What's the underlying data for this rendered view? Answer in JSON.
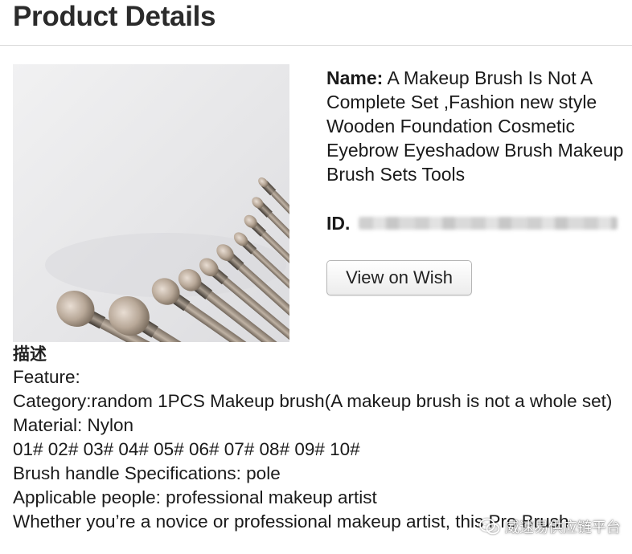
{
  "page": {
    "title": "Product Details"
  },
  "product": {
    "image_alt": "Makeup brush set",
    "name_label": "Name:",
    "name_value": "A Makeup Brush Is Not A Complete Set ,Fashion new style Wooden Foundation Cosmetic Eyebrow Eyeshadow Brush Makeup Brush Sets Tools",
    "id_label": "ID.",
    "view_button_label": "View on Wish"
  },
  "description": {
    "heading": "描述",
    "lines": [
      "Feature:",
      "Category:random 1PCS Makeup brush(A makeup brush is not a whole set)",
      "Material: Nylon",
      "01# 02# 03# 04# 05# 06# 07# 08# 09# 10#",
      "Brush handle Specifications: pole",
      "Applicable people: professional makeup artist",
      "Whether you’re a novice or professional makeup artist, this Pro Brush"
    ]
  },
  "watermark": {
    "text": "威速易供应链平台",
    "icon": "wechat-icon"
  }
}
